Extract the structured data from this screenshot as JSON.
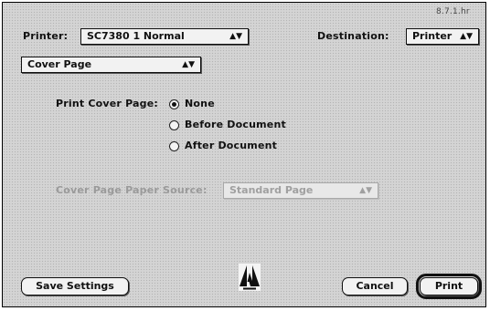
{
  "header": {
    "version": "8.7.1.hr",
    "printer_label": "Printer:",
    "printer_value": "SC7380 1 Normal",
    "destination_label": "Destination:",
    "destination_value": "Printer"
  },
  "section_popup": {
    "value": "Cover Page"
  },
  "cover_page": {
    "label": "Print Cover Page:",
    "options": [
      "None",
      "Before Document",
      "After Document"
    ],
    "selected": "None"
  },
  "paper_source": {
    "label": "Cover Page Paper Source:",
    "value": "Standard Page"
  },
  "footer": {
    "save_settings_label": "Save Settings",
    "cancel_label": "Cancel",
    "print_label": "Print"
  },
  "icons": {
    "popup_arrow": "updown-arrow-icon",
    "logo": "adobe-logo-icon"
  }
}
